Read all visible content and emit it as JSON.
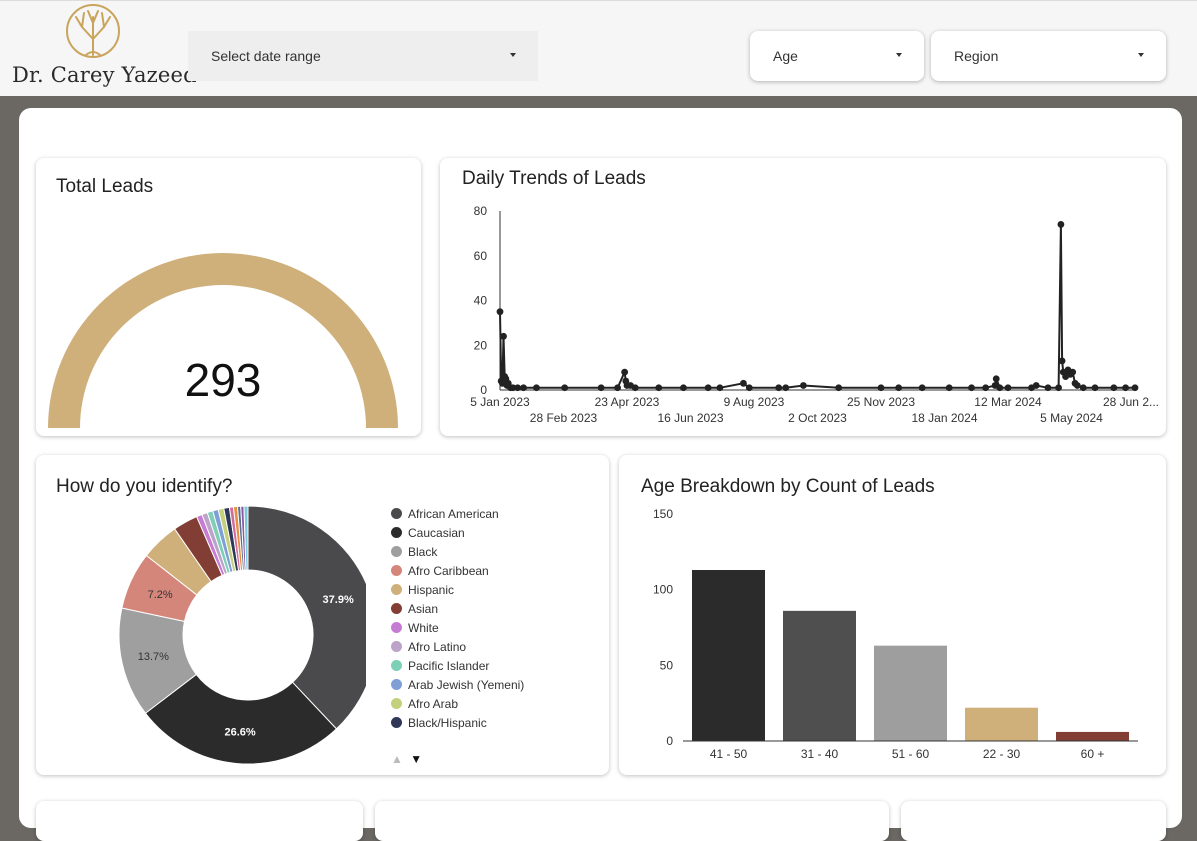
{
  "header": {
    "logo_text": "Dr. Carey Yazeed",
    "date_filter": "Select date range",
    "age_filter": "Age",
    "region_filter": "Region"
  },
  "total_leads": {
    "title": "Total Leads",
    "value": "293",
    "color": "#cfb07a"
  },
  "daily_trends": {
    "title": "Daily Trends of Leads"
  },
  "identify": {
    "title": "How do you identify?",
    "legend_pager_up": "▲",
    "legend_pager_down": "▼"
  },
  "age_breakdown": {
    "title": "Age Breakdown by Count of Leads"
  },
  "chart_data": [
    {
      "type": "line",
      "title": "Daily Trends of Leads",
      "ylim": [
        0,
        80
      ],
      "yticks": [
        "0",
        "20",
        "40",
        "60",
        "80"
      ],
      "xticks_row1": [
        "5 Jan 2023",
        "23 Apr 2023",
        "9 Aug 2023",
        "25 Nov 2023",
        "12 Mar 2024",
        "28 Jun 2..."
      ],
      "xticks_row2": [
        "28 Feb 2023",
        "16 Jun 2023",
        "2 Oct 2023",
        "18 Jan 2024",
        "5 May 2024"
      ],
      "x_start": "2023-01-05",
      "x_end": "2024-06-28",
      "series": [
        {
          "points": [
            [
              "2023-01-05",
              35
            ],
            [
              "2023-01-06",
              4
            ],
            [
              "2023-01-07",
              3
            ],
            [
              "2023-01-08",
              24
            ],
            [
              "2023-01-09",
              6
            ],
            [
              "2023-01-10",
              5
            ],
            [
              "2023-01-11",
              2
            ],
            [
              "2023-01-12",
              3
            ],
            [
              "2023-01-14",
              1
            ],
            [
              "2023-01-16",
              1
            ],
            [
              "2023-01-20",
              1
            ],
            [
              "2023-01-25",
              1
            ],
            [
              "2023-02-05",
              1
            ],
            [
              "2023-03-01",
              1
            ],
            [
              "2023-04-01",
              1
            ],
            [
              "2023-04-15",
              1
            ],
            [
              "2023-04-21",
              8
            ],
            [
              "2023-04-22",
              4
            ],
            [
              "2023-04-23",
              2
            ],
            [
              "2023-04-26",
              2
            ],
            [
              "2023-04-30",
              1
            ],
            [
              "2023-05-20",
              1
            ],
            [
              "2023-06-10",
              1
            ],
            [
              "2023-07-01",
              1
            ],
            [
              "2023-07-11",
              1
            ],
            [
              "2023-07-31",
              3
            ],
            [
              "2023-08-05",
              1
            ],
            [
              "2023-08-30",
              1
            ],
            [
              "2023-09-05",
              1
            ],
            [
              "2023-09-20",
              2
            ],
            [
              "2023-10-20",
              1
            ],
            [
              "2023-11-25",
              1
            ],
            [
              "2023-12-10",
              1
            ],
            [
              "2023-12-30",
              1
            ],
            [
              "2024-01-22",
              1
            ],
            [
              "2024-02-10",
              1
            ],
            [
              "2024-02-22",
              1
            ],
            [
              "2024-03-01",
              2
            ],
            [
              "2024-03-02",
              5
            ],
            [
              "2024-03-05",
              1
            ],
            [
              "2024-03-12",
              1
            ],
            [
              "2024-04-01",
              1
            ],
            [
              "2024-04-05",
              2
            ],
            [
              "2024-04-15",
              1
            ],
            [
              "2024-04-24",
              1
            ],
            [
              "2024-04-26",
              74
            ],
            [
              "2024-04-27",
              13
            ],
            [
              "2024-04-28",
              8
            ],
            [
              "2024-04-30",
              6
            ],
            [
              "2024-05-02",
              9
            ],
            [
              "2024-05-04",
              7
            ],
            [
              "2024-05-06",
              8
            ],
            [
              "2024-05-08",
              3
            ],
            [
              "2024-05-10",
              2
            ],
            [
              "2024-05-15",
              1
            ],
            [
              "2024-05-25",
              1
            ],
            [
              "2024-06-10",
              1
            ],
            [
              "2024-06-20",
              1
            ],
            [
              "2024-06-28",
              1
            ]
          ]
        }
      ]
    },
    {
      "type": "pie",
      "title": "How do you identify?",
      "categories": [
        "African American",
        "Caucasian",
        "Black",
        "Afro Caribbean",
        "Hispanic",
        "Asian",
        "White",
        "Afro Latino",
        "Pacific Islander",
        "Arab Jewish (Yemeni)",
        "Afro Arab",
        "Black/Hispanic"
      ],
      "values": [
        37.9,
        26.6,
        13.7,
        7.2,
        4.8,
        3.1,
        0.7,
        0.7,
        0.7,
        0.7,
        0.7,
        0.7
      ],
      "other_slices": [
        {
          "color": "#d36b9b",
          "value": 0.5
        },
        {
          "color": "#e58f43",
          "value": 0.5
        },
        {
          "color": "#5b6f8e",
          "value": 0.4
        },
        {
          "color": "#8a5aa5",
          "value": 0.4
        },
        {
          "color": "#7cc8dd",
          "value": 0.5
        }
      ],
      "labels_shown": [
        "37.9%",
        "26.6%",
        "13.7%",
        "7.2%"
      ],
      "colors": [
        "#4a4a4c",
        "#2b2b2b",
        "#9f9f9f",
        "#d4867b",
        "#cfb07a",
        "#823e34",
        "#c77cd3",
        "#bba3c9",
        "#7dcfb6",
        "#7f9fd6",
        "#c3d17c",
        "#2e3757"
      ]
    },
    {
      "type": "bar",
      "title": "Age Breakdown by Count of Leads",
      "categories": [
        "41 - 50",
        "31 - 40",
        "51 - 60",
        "22 - 30",
        "60 +"
      ],
      "values": [
        113,
        86,
        63,
        22,
        6
      ],
      "ylim": [
        0,
        150
      ],
      "yticks": [
        "0",
        "50",
        "100",
        "150"
      ],
      "colors": [
        "#2b2b2b",
        "#4f4f4f",
        "#9e9e9e",
        "#cfb07a",
        "#823e34"
      ]
    }
  ]
}
